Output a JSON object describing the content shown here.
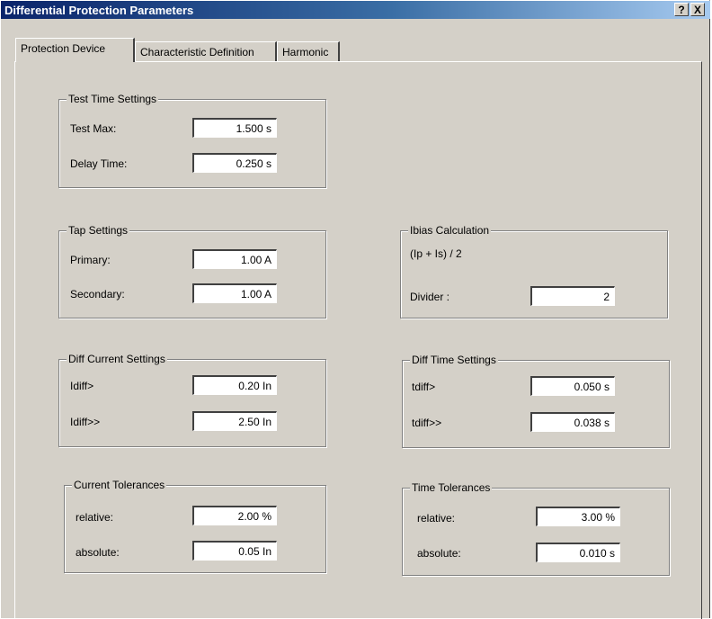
{
  "window": {
    "title": "Differential Protection Parameters",
    "help_button": "?",
    "close_button": "X"
  },
  "tabs": [
    {
      "label": "Protection Device",
      "active": true
    },
    {
      "label": "Characteristic Definition",
      "active": false
    },
    {
      "label": "Harmonic",
      "active": false
    }
  ],
  "groups": {
    "test_time": {
      "title": "Test Time Settings",
      "test_max_label": "Test Max:",
      "test_max_value": "1.500 s",
      "delay_label": "Delay Time:",
      "delay_value": "0.250 s"
    },
    "tap": {
      "title": "Tap Settings",
      "primary_label": "Primary:",
      "primary_value": "1.00 A",
      "secondary_label": "Secondary:",
      "secondary_value": "1.00 A"
    },
    "ibias": {
      "title": "Ibias Calculation",
      "formula": "(Ip + Is) / 2",
      "divider_label": "Divider :",
      "divider_value": "2"
    },
    "diff_current": {
      "title": "Diff Current Settings",
      "idiff1_label": "Idiff>",
      "idiff1_value": "0.20 In",
      "idiff2_label": "Idiff>>",
      "idiff2_value": "2.50 In"
    },
    "diff_time": {
      "title": "Diff Time Settings",
      "tdiff1_label": "tdiff>",
      "tdiff1_value": "0.050 s",
      "tdiff2_label": "tdiff>>",
      "tdiff2_value": "0.038 s"
    },
    "current_tol": {
      "title": "Current Tolerances",
      "relative_label": "relative:",
      "relative_value": "2.00 %",
      "absolute_label": "absolute:",
      "absolute_value": "0.05 In"
    },
    "time_tol": {
      "title": "Time Tolerances",
      "relative_label": "relative:",
      "relative_value": "3.00 %",
      "absolute_label": "absolute:",
      "absolute_value": "0.010 s"
    }
  }
}
